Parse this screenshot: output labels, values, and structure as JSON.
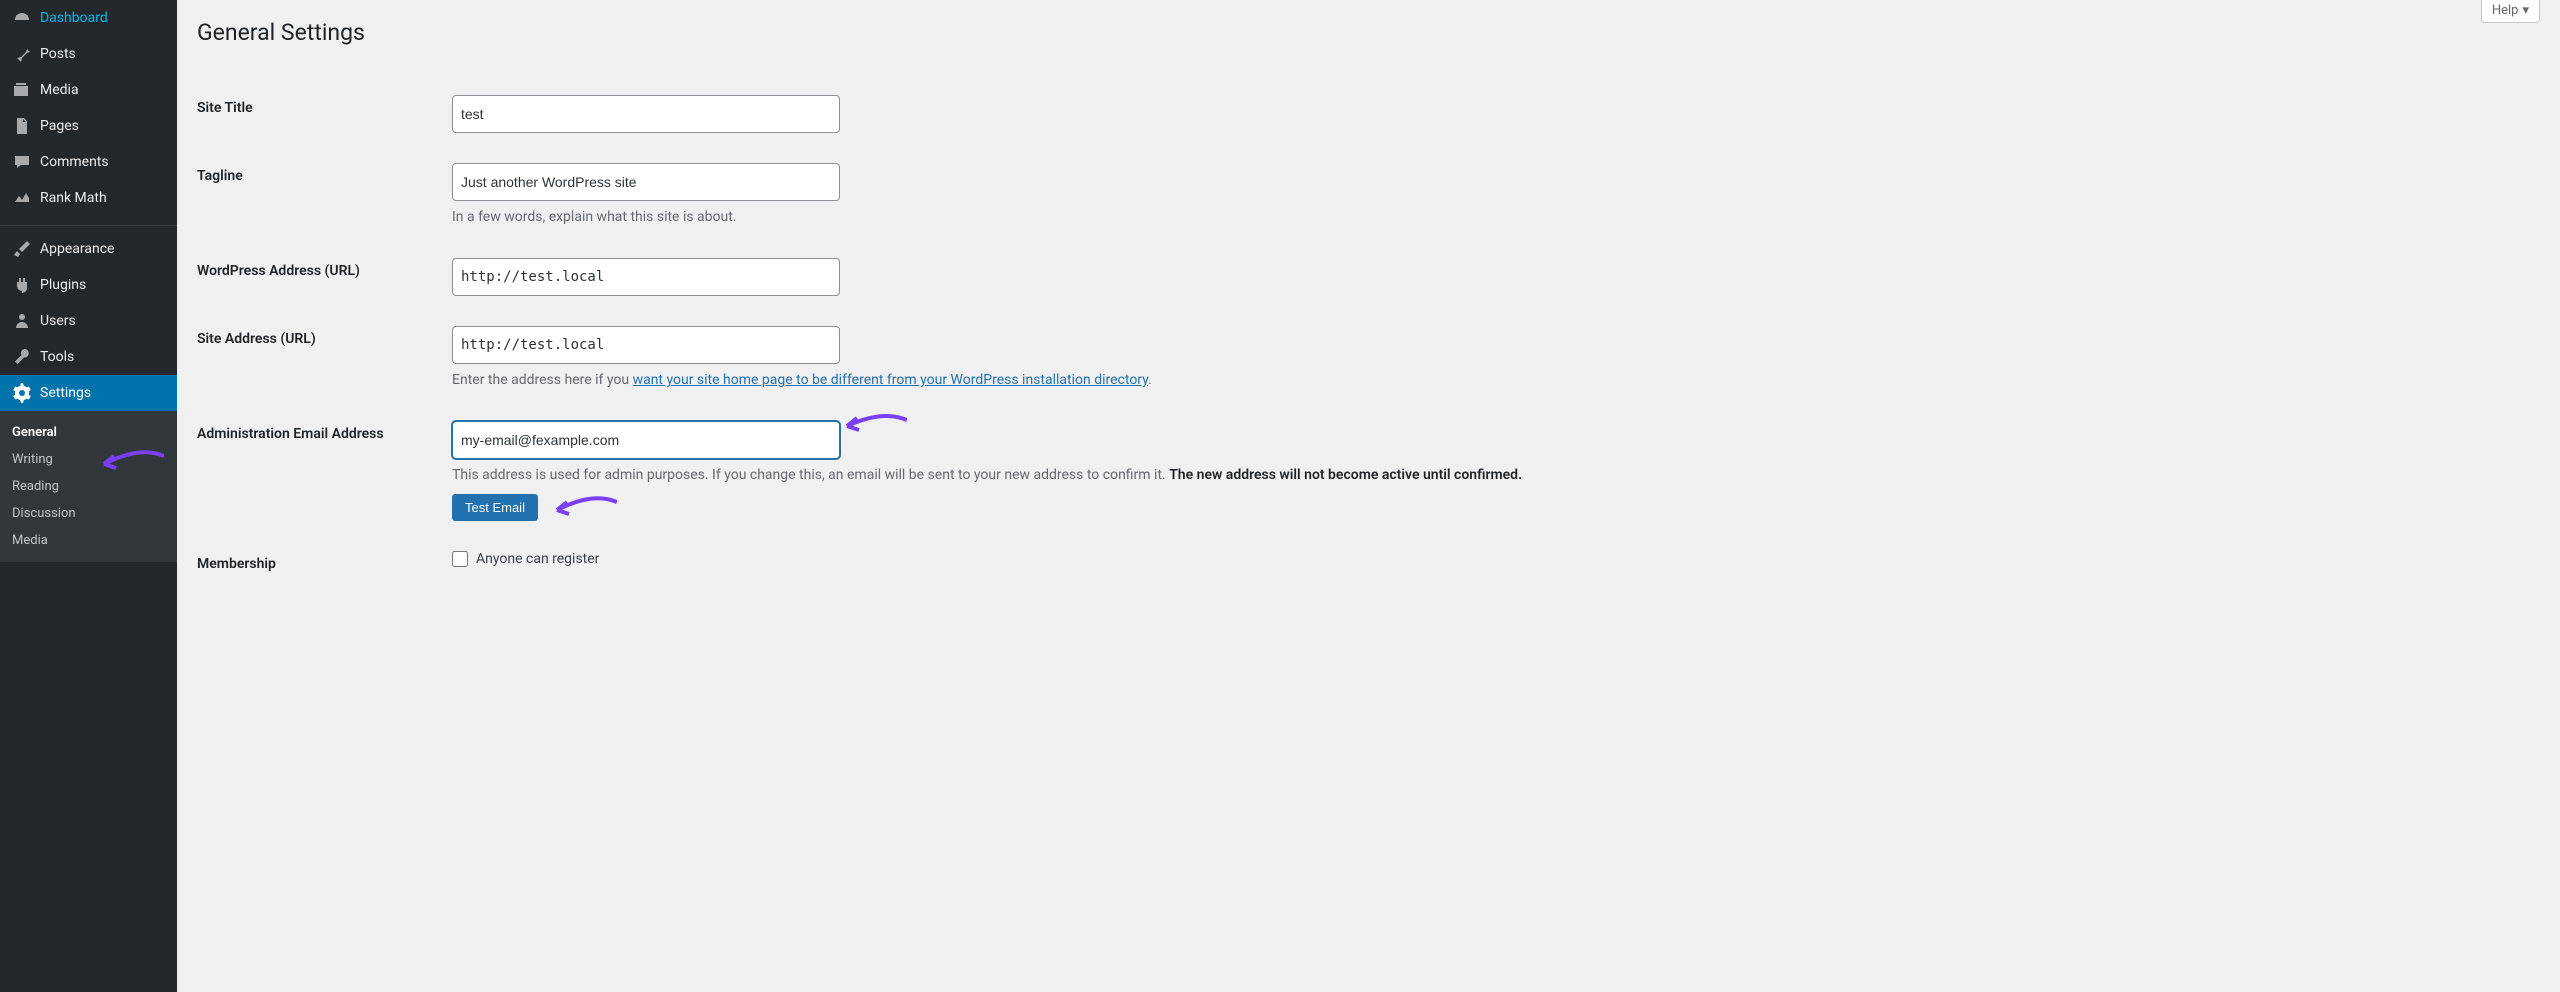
{
  "header": {
    "help_label": "Help"
  },
  "page": {
    "title": "General Settings"
  },
  "sidebar": {
    "items": [
      {
        "label": "Dashboard",
        "icon": "dashboard"
      },
      {
        "label": "Posts",
        "icon": "pin"
      },
      {
        "label": "Media",
        "icon": "media"
      },
      {
        "label": "Pages",
        "icon": "page"
      },
      {
        "label": "Comments",
        "icon": "comment"
      },
      {
        "label": "Rank Math",
        "icon": "chart"
      },
      {
        "label": "Appearance",
        "icon": "brush"
      },
      {
        "label": "Plugins",
        "icon": "plug"
      },
      {
        "label": "Users",
        "icon": "user"
      },
      {
        "label": "Tools",
        "icon": "wrench"
      },
      {
        "label": "Settings",
        "icon": "gear"
      }
    ],
    "submenu": [
      {
        "label": "General"
      },
      {
        "label": "Writing"
      },
      {
        "label": "Reading"
      },
      {
        "label": "Discussion"
      },
      {
        "label": "Media"
      }
    ]
  },
  "form": {
    "site_title": {
      "label": "Site Title",
      "value": "test"
    },
    "tagline": {
      "label": "Tagline",
      "value": "Just another WordPress site",
      "description": "In a few words, explain what this site is about."
    },
    "wp_address": {
      "label": "WordPress Address (URL)",
      "value": "http://test.local"
    },
    "site_address": {
      "label": "Site Address (URL)",
      "value": "http://test.local",
      "desc_prefix": "Enter the address here if you ",
      "desc_link": "want your site home page to be different from your WordPress installation directory",
      "desc_suffix": "."
    },
    "admin_email": {
      "label": "Administration Email Address",
      "value": "my-email@fexample.com",
      "desc_part1": "This address is used for admin purposes. If you change this, an email will be sent to your new address to confirm it. ",
      "desc_strong": "The new address will not become active until confirmed.",
      "test_button": "Test Email"
    },
    "membership": {
      "label": "Membership",
      "checkbox_label": "Anyone can register"
    }
  }
}
